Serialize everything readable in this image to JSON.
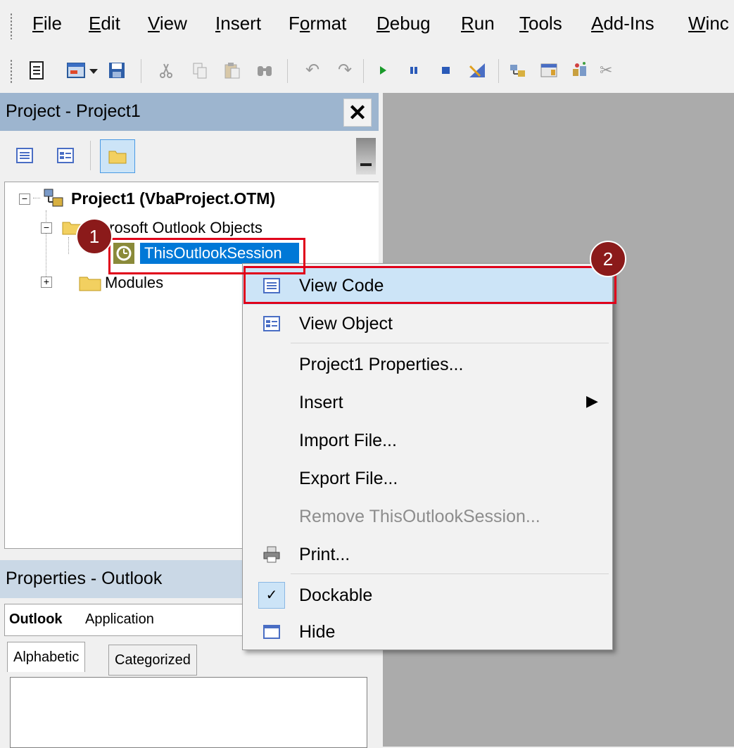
{
  "menubar": {
    "items": [
      {
        "label": "File",
        "ul": "F"
      },
      {
        "label": "Edit",
        "ul": "E"
      },
      {
        "label": "View",
        "ul": "V"
      },
      {
        "label": "Insert",
        "ul": "I"
      },
      {
        "label": "Format",
        "ul": "o"
      },
      {
        "label": "Debug",
        "ul": "D"
      },
      {
        "label": "Run",
        "ul": "R"
      },
      {
        "label": "Tools",
        "ul": "T"
      },
      {
        "label": "Add-Ins",
        "ul": "A"
      },
      {
        "label": "Winc",
        "ul": "W"
      }
    ]
  },
  "toolbar": {
    "icons": [
      "view-excel-icon",
      "insert-userform-icon",
      "dropdown-arrow-icon",
      "save-icon",
      "cut-icon",
      "copy-icon",
      "paste-icon",
      "find-icon",
      "undo-icon",
      "redo-icon",
      "run-icon",
      "break-icon",
      "reset-icon",
      "design-mode-icon",
      "project-explorer-icon",
      "properties-window-icon",
      "object-browser-icon",
      "toolbox-icon"
    ]
  },
  "project_pane": {
    "title": "Project - Project1",
    "close_glyph": "✕",
    "tree": {
      "root": "Project1 (VbaProject.OTM)",
      "folder_objects": "Microsoft Outlook Objects",
      "item_session": "ThisOutlookSession",
      "folder_modules": "Modules"
    }
  },
  "properties_pane": {
    "title": "Properties - Outlook",
    "object_name": "Outlook",
    "object_type": "Application",
    "tabs": [
      "Alphabetic",
      "Categorized"
    ]
  },
  "context_menu": {
    "items": [
      {
        "label": "View Code",
        "icon": "view-code-icon",
        "highlighted": true
      },
      {
        "label": "View Object",
        "icon": "view-object-icon"
      },
      {
        "label": "Project1 Properties..."
      },
      {
        "label": "Insert",
        "submenu_arrow": "▶"
      },
      {
        "label": "Import File..."
      },
      {
        "label": "Export File..."
      },
      {
        "label": "Remove ThisOutlookSession...",
        "disabled": true
      },
      {
        "label": "Print...",
        "icon": "print-icon"
      },
      {
        "label": "Dockable",
        "icon": "checkmark-icon",
        "checked": true
      },
      {
        "label": "Hide",
        "icon": "hide-window-icon"
      }
    ]
  },
  "annotations": {
    "step1": "1",
    "step2": "2",
    "highlight_color": "#e0001a",
    "badge_color": "#8b1a1a"
  },
  "colors": {
    "selection": "#0078d7",
    "menu_highlight": "#cce4f7",
    "workspace": "#ababab",
    "pane_title_active": "#9db5cf"
  }
}
